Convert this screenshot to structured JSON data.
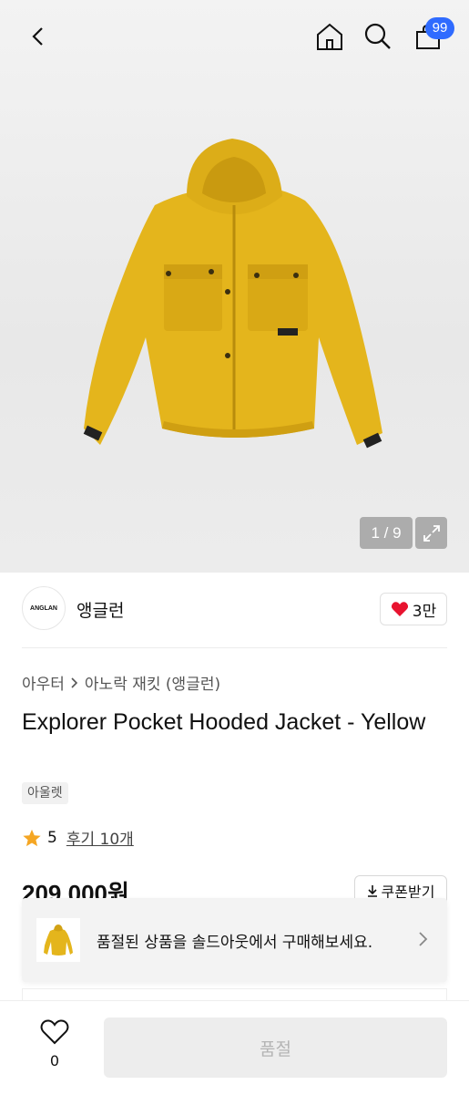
{
  "header": {
    "cart_count": "99",
    "icons": [
      "back-icon",
      "home-icon",
      "search-icon",
      "cart-icon"
    ]
  },
  "gallery": {
    "counter": "1 / 9",
    "product_color": "#e8b820"
  },
  "brand": {
    "logo_text": "ANGLAN",
    "name": "앵글런",
    "like_count": "3만"
  },
  "breadcrumb": {
    "category": "아우터",
    "subcategory": "아노락 재킷 (앵글런)"
  },
  "product": {
    "title": "Explorer Pocket Hooded Jacket - Yellow",
    "tag": "아울렛",
    "rating": "5",
    "reviews": "후기 10개",
    "price": "209,000원",
    "coupon_label": "쿠폰받기"
  },
  "soldout_banner": {
    "text": "품절된 상품을 솔드아웃에서 구매해보세요."
  },
  "bottom_bar": {
    "wish_count": "0",
    "buy_label": "품절"
  },
  "colors": {
    "accent_badge": "#2f6bff",
    "heart": "#e8132f",
    "star": "#f5a623"
  }
}
